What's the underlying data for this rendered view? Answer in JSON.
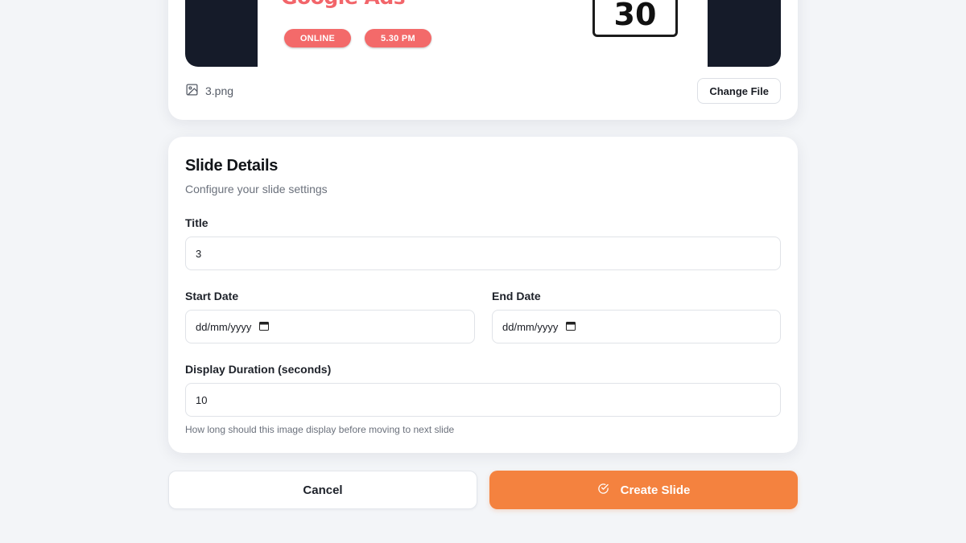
{
  "preview": {
    "ad_headline": "Google Ads",
    "pill_online": "ONLINE",
    "pill_time": "5.30 PM",
    "date_number": "30",
    "file_icon": "image-icon",
    "file_name": "3.png",
    "change_file_label": "Change File"
  },
  "details": {
    "title": "Slide Details",
    "subtitle": "Configure your slide settings",
    "title_label": "Title",
    "title_value": "3",
    "start_date_label": "Start Date",
    "start_date_value": "dd/mm/yyyy",
    "end_date_label": "End Date",
    "end_date_value": "dd/mm/yyyy",
    "calendar_icon": "calendar-icon",
    "duration_label": "Display Duration (seconds)",
    "duration_value": "10",
    "duration_help": "How long should this image display before moving to next slide"
  },
  "actions": {
    "cancel_label": "Cancel",
    "create_label": "Create Slide",
    "create_icon": "check-circle-icon"
  },
  "colors": {
    "page_background": "#f3f5f8",
    "accent_orange": "#f4823f",
    "ad_coral": "#f2656a",
    "preview_dark": "#151b29"
  }
}
